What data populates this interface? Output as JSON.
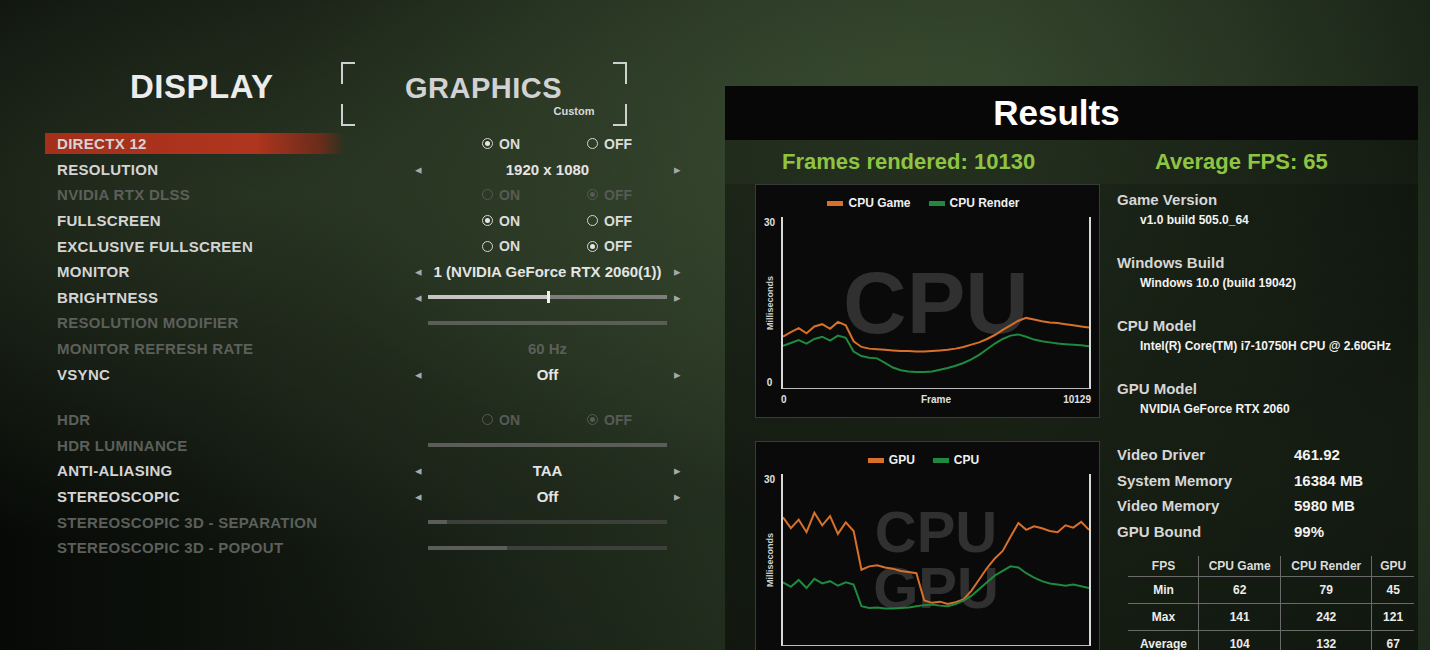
{
  "tabs": [
    {
      "label": "DISPLAY",
      "selected": true,
      "focused": false
    },
    {
      "label": "GRAPHICS",
      "selected": false,
      "focused": true,
      "subtitle": "Custom"
    }
  ],
  "arrows": {
    "left": "◂",
    "right": "▸"
  },
  "settings_groups": [
    {
      "rows": [
        {
          "label": "DIRECTX 12",
          "kind": "radio",
          "highlighted": true,
          "disabled": false,
          "options": [
            {
              "label": "ON",
              "selected": true
            },
            {
              "label": "OFF",
              "selected": false
            }
          ]
        },
        {
          "label": "RESOLUTION",
          "kind": "select",
          "highlighted": false,
          "disabled": false,
          "value": "1920 x 1080"
        },
        {
          "label": "NVIDIA RTX DLSS",
          "kind": "radio",
          "highlighted": false,
          "disabled": true,
          "options": [
            {
              "label": "ON",
              "selected": false
            },
            {
              "label": "OFF",
              "selected": true
            }
          ]
        },
        {
          "label": "FULLSCREEN",
          "kind": "radio",
          "highlighted": false,
          "disabled": false,
          "options": [
            {
              "label": "ON",
              "selected": true
            },
            {
              "label": "OFF",
              "selected": false
            }
          ]
        },
        {
          "label": "EXCLUSIVE FULLSCREEN",
          "kind": "radio",
          "highlighted": false,
          "disabled": false,
          "options": [
            {
              "label": "ON",
              "selected": false
            },
            {
              "label": "OFF",
              "selected": true
            }
          ]
        },
        {
          "label": "MONITOR",
          "kind": "select",
          "highlighted": false,
          "disabled": false,
          "value": "1 (NVIDIA GeForce RTX 2060(1))"
        },
        {
          "label": "BRIGHTNESS",
          "kind": "slider",
          "highlighted": false,
          "disabled": false,
          "level": 0.5
        },
        {
          "label": "RESOLUTION MODIFIER",
          "kind": "slider",
          "highlighted": false,
          "disabled": true,
          "level": 1
        },
        {
          "label": "MONITOR REFRESH RATE",
          "kind": "select",
          "highlighted": false,
          "disabled": true,
          "value": "60 Hz"
        },
        {
          "label": "VSYNC",
          "kind": "select",
          "highlighted": false,
          "disabled": false,
          "value": "Off"
        }
      ]
    },
    {
      "rows": [
        {
          "label": "HDR",
          "kind": "radio",
          "highlighted": false,
          "disabled": true,
          "options": [
            {
              "label": "ON",
              "selected": false
            },
            {
              "label": "OFF",
              "selected": true
            }
          ]
        },
        {
          "label": "HDR LUMINANCE",
          "kind": "slider",
          "highlighted": false,
          "disabled": true,
          "level": 1
        },
        {
          "label": "ANTI-ALIASING",
          "kind": "select",
          "highlighted": false,
          "disabled": false,
          "value": "TAA"
        },
        {
          "label": "STEREOSCOPIC",
          "kind": "select",
          "highlighted": false,
          "disabled": false,
          "value": "Off"
        },
        {
          "label": "STEREOSCOPIC 3D - SEPARATION",
          "kind": "slider",
          "highlighted": false,
          "disabled": true,
          "level": 0.08
        },
        {
          "label": "STEREOSCOPIC 3D - POPOUT",
          "kind": "slider",
          "highlighted": false,
          "disabled": true,
          "level": 0.33
        }
      ]
    }
  ],
  "results": {
    "title": "Results",
    "frames_rendered": "Frames rendered: 10130",
    "average_fps": "Average FPS: 65",
    "charts": [
      {
        "watermark": [
          "CPU"
        ],
        "y_label": "Milliseconds",
        "y_ticks": [
          "30",
          "0"
        ],
        "x_label": "Frame",
        "x_ticks": [
          "0",
          "10129"
        ],
        "series": [
          {
            "name": "CPU Game",
            "color": "#d8702a",
            "values": [
              9.0,
              9.8,
              10.5,
              9.6,
              10.8,
              11.2,
              10.4,
              11.6,
              11.0,
              8.2,
              7.2,
              6.9,
              6.8,
              6.7,
              6.6,
              6.5,
              6.5,
              6.4,
              6.4,
              6.5,
              6.6,
              6.7,
              6.9,
              7.2,
              7.6,
              8.0,
              8.6,
              9.3,
              10.2,
              11.0,
              11.8,
              12.3,
              12.0,
              11.7,
              11.5,
              11.4,
              11.2,
              11.0,
              10.8,
              10.6
            ]
          },
          {
            "name": "CPU Render",
            "color": "#1f8a3e",
            "values": [
              7.4,
              7.9,
              8.4,
              7.8,
              8.6,
              9.0,
              8.3,
              9.2,
              8.8,
              6.4,
              5.6,
              5.3,
              5.2,
              4.4,
              3.6,
              3.1,
              2.9,
              2.8,
              2.8,
              2.9,
              3.2,
              3.5,
              3.9,
              4.4,
              5.0,
              5.8,
              6.8,
              7.8,
              8.6,
              9.2,
              9.4,
              9.0,
              8.5,
              8.2,
              8.0,
              7.8,
              7.7,
              7.6,
              7.5,
              7.3
            ]
          }
        ]
      },
      {
        "watermark": [
          "CPU",
          "GPU"
        ],
        "y_label": "Milliseconds",
        "y_ticks": [
          "30"
        ],
        "x_label": "",
        "x_ticks": [],
        "series": [
          {
            "name": "GPU",
            "color": "#d8702a",
            "values": [
              22.4,
              20.5,
              22.0,
              19.8,
              23.2,
              21.0,
              22.6,
              19.5,
              21.5,
              20.0,
              13.2,
              13.8,
              14.0,
              13.6,
              13.4,
              13.0,
              12.8,
              12.6,
              7.8,
              7.4,
              7.6,
              7.2,
              7.5,
              8.0,
              9.5,
              11.5,
              13.5,
              15.2,
              16.5,
              19.0,
              21.4,
              20.2,
              20.8,
              20.5,
              20.0,
              19.8,
              21.0,
              20.6,
              21.6,
              20.2
            ]
          },
          {
            "name": "CPU",
            "color": "#1f8a3e",
            "values": [
              11.0,
              10.2,
              11.4,
              10.0,
              11.6,
              10.8,
              11.2,
              10.4,
              11.0,
              10.6,
              6.8,
              6.5,
              6.6,
              6.4,
              6.4,
              6.5,
              6.6,
              6.8,
              7.0,
              7.1,
              6.9,
              6.8,
              7.2,
              7.8,
              8.6,
              9.8,
              11.0,
              12.2,
              13.0,
              13.8,
              13.6,
              12.6,
              11.8,
              11.2,
              10.8,
              10.6,
              10.4,
              10.6,
              10.3,
              10.0
            ]
          }
        ]
      }
    ],
    "info": [
      {
        "label": "Game Version",
        "value": "v1.0 build 505.0_64"
      },
      {
        "label": "Windows Build",
        "value": "Windows 10.0 (build 19042)"
      },
      {
        "label": "CPU Model",
        "value": "Intel(R) Core(TM) i7-10750H CPU @ 2.60GHz"
      },
      {
        "label": "GPU Model",
        "value": "NVIDIA GeForce RTX 2060"
      }
    ],
    "details": [
      {
        "label": "Video Driver",
        "value": "461.92"
      },
      {
        "label": "System Memory",
        "value": "16384 MB"
      },
      {
        "label": "Video Memory",
        "value": "5980 MB"
      },
      {
        "label": "GPU Bound",
        "value": "99%"
      }
    ],
    "table": {
      "columns": [
        "FPS",
        "CPU Game",
        "CPU Render",
        "GPU"
      ],
      "rows": [
        [
          "Min",
          "62",
          "79",
          "45"
        ],
        [
          "Max",
          "141",
          "242",
          "121"
        ],
        [
          "Average",
          "104",
          "132",
          "67"
        ]
      ]
    }
  }
}
